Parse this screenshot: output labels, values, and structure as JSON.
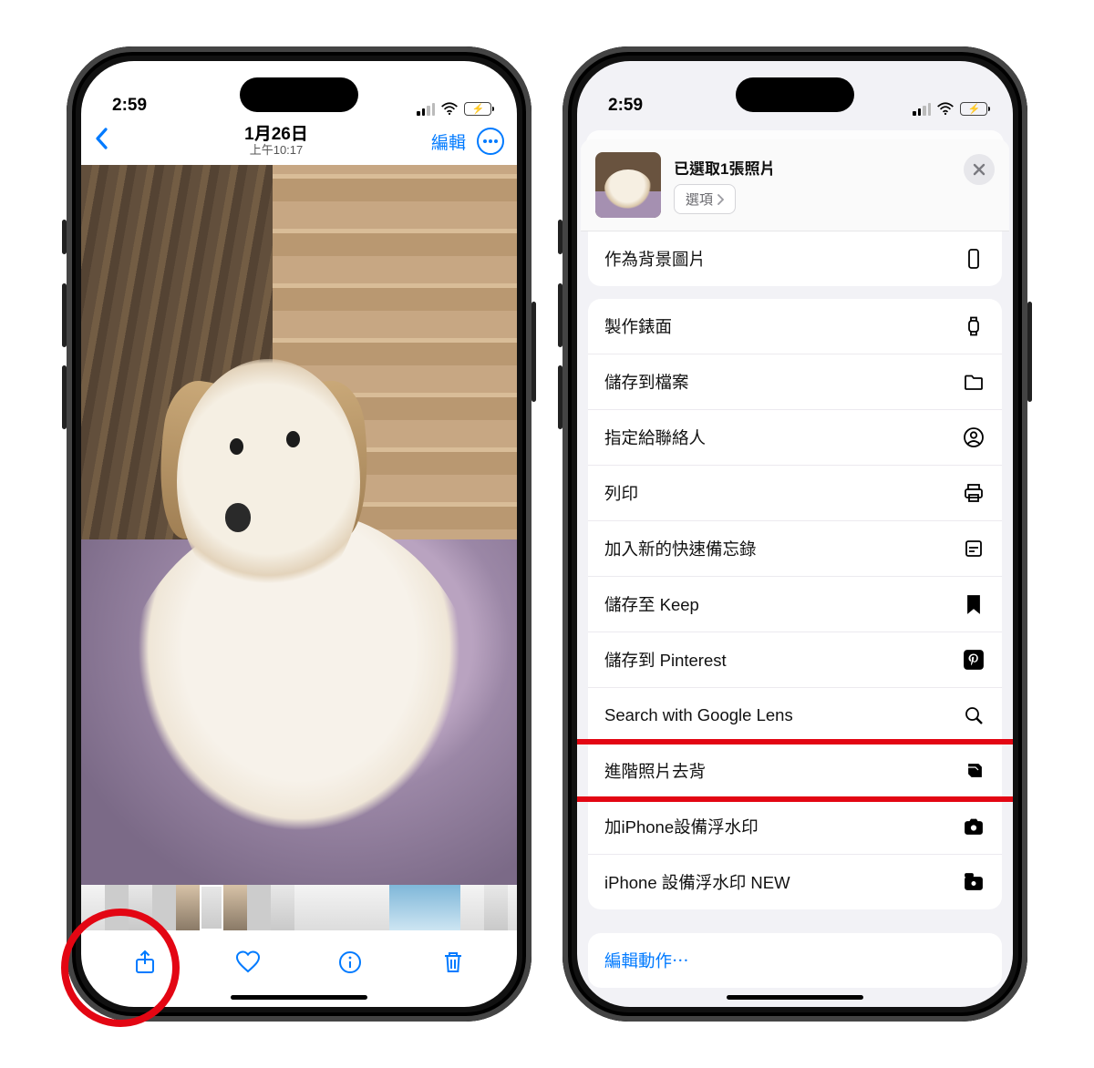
{
  "status": {
    "time": "2:59"
  },
  "left": {
    "nav": {
      "date": "1月26日",
      "time_sub": "上午10:17",
      "edit": "編輯"
    },
    "toolbar_icons": [
      "share-icon",
      "heart-icon",
      "info-icon",
      "trash-icon"
    ]
  },
  "right": {
    "header": {
      "title": "已選取1張照片",
      "options_label": "選項"
    },
    "group_top": [
      {
        "label": "作為背景圖片",
        "icon": "phone-outline-icon"
      }
    ],
    "group_main": [
      {
        "label": "製作錶面",
        "icon": "watch-icon"
      },
      {
        "label": "儲存到檔案",
        "icon": "folder-icon"
      },
      {
        "label": "指定給聯絡人",
        "icon": "person-circle-icon"
      },
      {
        "label": "列印",
        "icon": "printer-icon"
      },
      {
        "label": "加入新的快速備忘錄",
        "icon": "note-icon"
      },
      {
        "label": "儲存至 Keep",
        "icon": "bookmark-icon"
      },
      {
        "label": "儲存到 Pinterest",
        "icon": "pinterest-icon"
      },
      {
        "label": "Search with Google Lens",
        "icon": "magnify-icon"
      },
      {
        "label": "進階照片去背",
        "icon": "stack-icon",
        "highlight": true
      },
      {
        "label": "加iPhone設備浮水印",
        "icon": "camera-icon"
      },
      {
        "label": "iPhone 設備浮水印 NEW",
        "icon": "camera-badge-icon"
      }
    ],
    "edit_actions": "編輯動作⋯"
  }
}
